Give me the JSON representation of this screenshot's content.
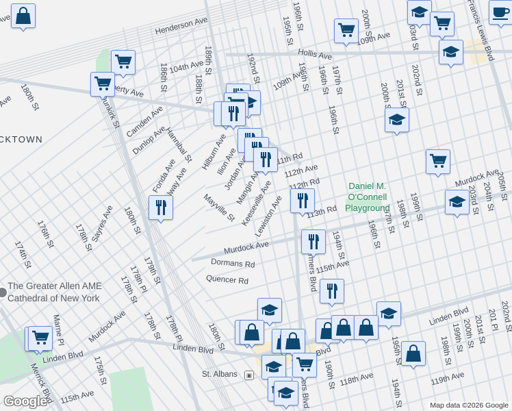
{
  "map": {
    "area_label": "CKTOWN",
    "park_label": "Daniel M.\nO'Connell\nPlayground",
    "poi_label": "The Greater Allen AME\nCathedral of New York",
    "station_label": "St. Albans",
    "station_icon": "train-icon",
    "attribution": "Map data ©2026 Google",
    "logo": "Google",
    "streets": [
      "Henderson Ave",
      "104th Ave",
      "Liberty Ave",
      "Dunkirk St",
      "186th St",
      "188th St",
      "189th St",
      "192nd St",
      "180th St",
      "Camden Ave",
      "Dunlop Ave",
      "Hannibal St",
      "Hilburn Ave",
      "Ilion Ave",
      "Jordan Ave",
      "Mangin Ave",
      "Keeseville Ave",
      "Lewiston Ave",
      "Fonda Ave",
      "Galway Ave",
      "Mayville St",
      "Hollis Ave",
      "195th St",
      "196th St",
      "195th St",
      "196th St",
      "197th St",
      "196th St",
      "200th St",
      "200th St",
      "201st St",
      "202nd St",
      "203rd St",
      "Francis Lewis Blvd",
      "109th Ave",
      "109th Ave",
      "112th Ave",
      "111th Rd",
      "Murdock Ave",
      "205th St",
      "204th St",
      "203rd St",
      "112th Rd",
      "113th Rd",
      "Murdock Ave",
      "Dormans Rd",
      "Quencer Rd",
      "Farmers Blvd",
      "194th St",
      "115th Ave",
      "196th St",
      "197th St",
      "198th St",
      "199th St",
      "176th St",
      "174th St",
      "178th St",
      "Sayres Ave",
      "180th St",
      "179th St",
      "178th Pl",
      "178th St",
      "178th St",
      "178th Pl",
      "180th St",
      "Murdock Ave",
      "Marne Pl",
      "Linden Blvd",
      "Linden Blvd",
      "Linden Blvd",
      "Linden Blvd",
      "175th St",
      "115th Ave",
      "Merrick Blvd",
      "190th St",
      "118th Ave",
      "119th Ave",
      "195th St",
      "194th St",
      "198th St",
      "199th St",
      "200th St",
      "201st St",
      "201 Pl",
      "202nd St",
      "Farmers Blvd",
      "Ave",
      "Ave"
    ],
    "markers": [
      "shopping-bag",
      "shopping-cart",
      "shopping-cart",
      "restaurant",
      "education",
      "shopping-cart",
      "restaurant",
      "restaurant",
      "restaurant",
      "restaurant",
      "restaurant",
      "restaurant",
      "shopping-cart",
      "education",
      "shopping-cart",
      "education",
      "coffee",
      "education",
      "shopping-cart",
      "education",
      "restaurant",
      "restaurant",
      "restaurant",
      "education",
      "education",
      "shopping-bag",
      "shopping-bag",
      "shopping-bag",
      "shopping-bag",
      "shopping-bag",
      "shopping-cart",
      "shopping-cart",
      "shopping-bag",
      "shopping-bag",
      "shopping-bag",
      "shopping-cart",
      "education",
      "education",
      "education"
    ]
  },
  "colors": {
    "marker_fill": "#e4ecfb",
    "marker_border": "#6a91d8",
    "marker_icon": "#0e4770",
    "park": "#c6ebd2",
    "road": "#d6dee6"
  }
}
